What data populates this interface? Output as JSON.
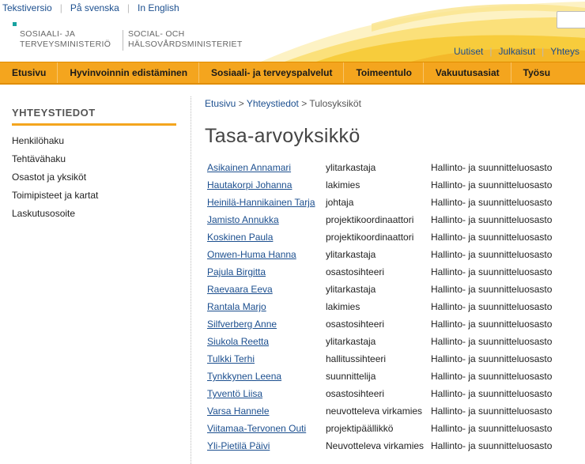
{
  "lang_links": [
    "Tekstiversio",
    "På svenska",
    "In English"
  ],
  "logo": {
    "fi_line1": "SOSIAALI- JA",
    "fi_line2": "TERVEYSMINISTERIÖ",
    "sv_line1": "SOCIAL- OCH",
    "sv_line2": "HÄLSOVÅRDSMINISTERIET"
  },
  "util_links": [
    "Uutiset",
    "Julkaisut",
    "Yhteys"
  ],
  "mainnav": [
    "Etusivu",
    "Hyvinvoinnin edistäminen",
    "Sosiaali- ja terveyspalvelut",
    "Toimeentulo",
    "Vakuutusasiat",
    "Työsu"
  ],
  "sidebar": {
    "title": "YHTEYSTIEDOT",
    "items": [
      "Henkilöhaku",
      "Tehtävähaku",
      "Osastot ja yksiköt",
      "Toimipisteet ja kartat",
      "Laskutusosoite"
    ]
  },
  "breadcrumb": {
    "home": "Etusivu",
    "sep1": " > ",
    "contacts": "Yhteystiedot",
    "sep2": " > ",
    "current": "Tulosyksiköt"
  },
  "page_title": "Tasa-arvoyksikkö",
  "people": [
    {
      "name": "Asikainen Annamari",
      "title": "ylitarkastaja",
      "unit": "Hallinto- ja suunnitteluosasto"
    },
    {
      "name": "Hautakorpi Johanna",
      "title": "lakimies",
      "unit": "Hallinto- ja suunnitteluosasto"
    },
    {
      "name": "Heinilä-Hannikainen Tarja",
      "title": "johtaja",
      "unit": "Hallinto- ja suunnitteluosasto"
    },
    {
      "name": "Jamisto Annukka",
      "title": "projektikoordinaattori",
      "unit": "Hallinto- ja suunnitteluosasto"
    },
    {
      "name": "Koskinen Paula",
      "title": "projektikoordinaattori",
      "unit": "Hallinto- ja suunnitteluosasto"
    },
    {
      "name": "Onwen-Huma Hanna",
      "title": "ylitarkastaja",
      "unit": "Hallinto- ja suunnitteluosasto"
    },
    {
      "name": "Pajula Birgitta",
      "title": "osastosihteeri",
      "unit": "Hallinto- ja suunnitteluosasto"
    },
    {
      "name": "Raevaara Eeva",
      "title": "ylitarkastaja",
      "unit": "Hallinto- ja suunnitteluosasto"
    },
    {
      "name": "Rantala Marjo",
      "title": "lakimies",
      "unit": "Hallinto- ja suunnitteluosasto"
    },
    {
      "name": "Silfverberg Anne",
      "title": "osastosihteeri",
      "unit": "Hallinto- ja suunnitteluosasto"
    },
    {
      "name": "Siukola Reetta",
      "title": "ylitarkastaja",
      "unit": "Hallinto- ja suunnitteluosasto"
    },
    {
      "name": "Tulkki Terhi",
      "title": "hallitussihteeri",
      "unit": "Hallinto- ja suunnitteluosasto"
    },
    {
      "name": "Tynkkynen Leena",
      "title": "suunnittelija",
      "unit": "Hallinto- ja suunnitteluosasto"
    },
    {
      "name": "Tyventö Liisa",
      "title": "osastosihteeri",
      "unit": "Hallinto- ja suunnitteluosasto"
    },
    {
      "name": "Varsa Hannele",
      "title": "neuvotteleva virkamies",
      "unit": "Hallinto- ja suunnitteluosasto"
    },
    {
      "name": "Viitamaa-Tervonen Outi",
      "title": "projektipäällikkö",
      "unit": "Hallinto- ja suunnitteluosasto"
    },
    {
      "name": "Yli-Pietilä Päivi",
      "title": "Neuvotteleva virkamies",
      "unit": "Hallinto- ja suunnitteluosasto"
    }
  ],
  "colors": {
    "accent_orange": "#f4a51e",
    "link_blue": "#1c4f8f",
    "logo_teal": "#18a2a0"
  }
}
